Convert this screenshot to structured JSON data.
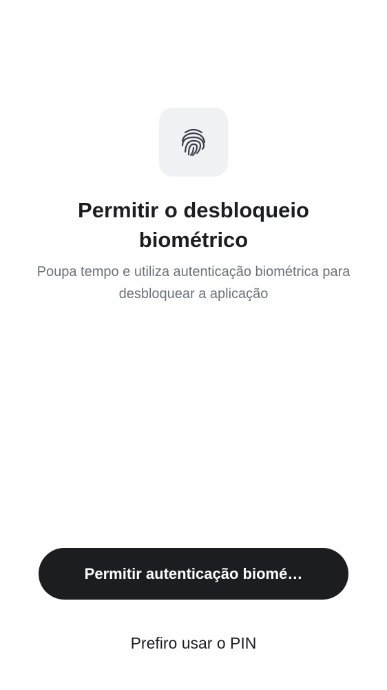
{
  "screen": {
    "icon": "fingerprint-icon",
    "title": "Permitir o desbloqueio biométrico",
    "subtitle": "Poupa tempo e utiliza autenticação biométrica para desbloquear a aplicação"
  },
  "actions": {
    "primary_label": "Permitir autenticação biomé…",
    "secondary_label": "Prefiro usar o PIN"
  },
  "colors": {
    "background": "#ffffff",
    "icon_tile": "#eff1f5",
    "primary_button": "#1c1d21",
    "title_text": "#1c1d21",
    "subtitle_text": "#6c717b"
  }
}
